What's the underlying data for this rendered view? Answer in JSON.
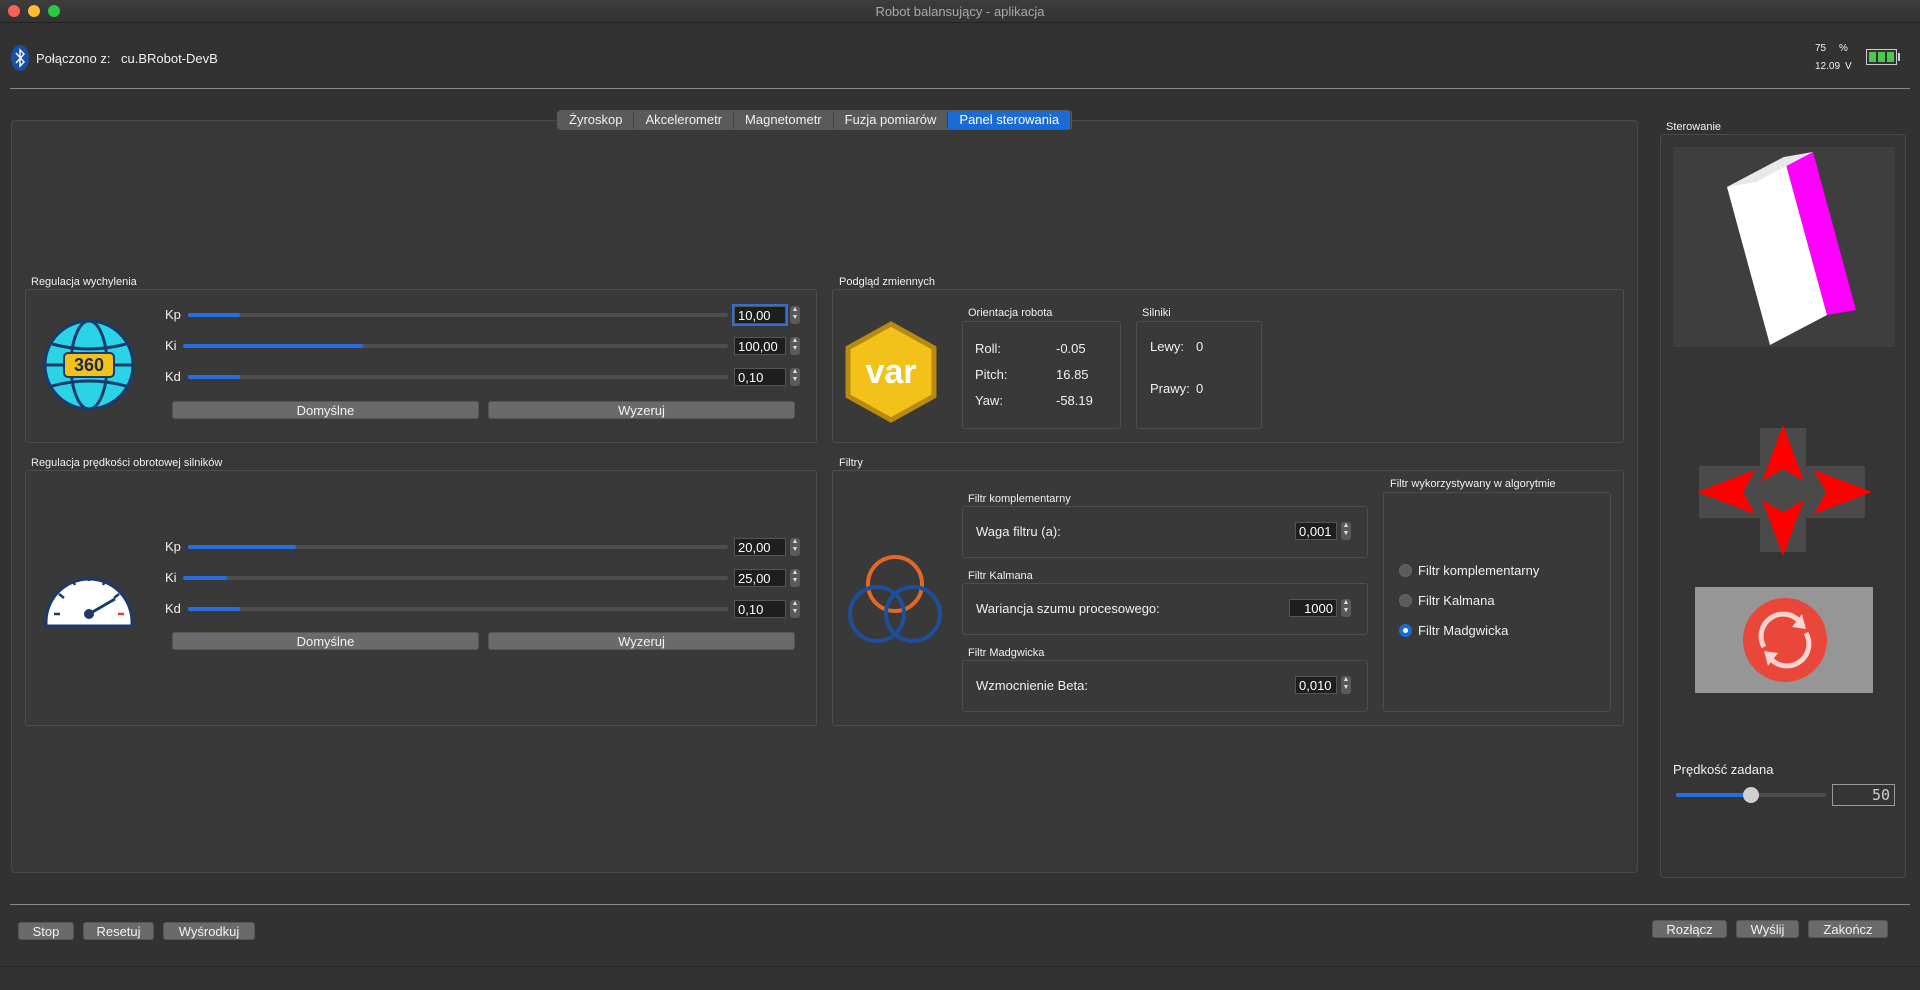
{
  "window": {
    "title": "Robot balansujący - aplikacja"
  },
  "header": {
    "connected_label": "Połączono z:",
    "device": "cu.BRobot-DevB",
    "battery_percent": "75",
    "percent_unit": "%",
    "voltage": "12.09",
    "voltage_unit": "V",
    "battery_level": 1.0
  },
  "tabs": [
    "Żyroskop",
    "Akcelerometr",
    "Magnetometr",
    "Fuzja pomiarów",
    "Panel sterowania"
  ],
  "active_tab": 4,
  "tilt": {
    "title": "Regulacja wychylenia",
    "icon_text": "360",
    "rows": [
      {
        "label": "Kp",
        "value": "10,00",
        "level": 0.1
      },
      {
        "label": "Ki",
        "value": "100,00",
        "level": 0.33
      },
      {
        "label": "Kd",
        "value": "0,10",
        "level": 0.1
      }
    ],
    "default_button": "Domyślne",
    "reset_button": "Wyzeruj"
  },
  "speed": {
    "title": "Regulacja prędkości obrotowej silników",
    "rows": [
      {
        "label": "Kp",
        "value": "20,00",
        "level": 0.2
      },
      {
        "label": "Ki",
        "value": "25,00",
        "level": 0.08
      },
      {
        "label": "Kd",
        "value": "0,10",
        "level": 0.1
      }
    ],
    "default_button": "Domyślne",
    "reset_button": "Wyzeruj"
  },
  "vars": {
    "title": "Podgląd zmiennych",
    "icon_text": "var",
    "orientation": {
      "title": "Orientacja robota",
      "roll_label": "Roll:",
      "roll": "-0.05",
      "pitch_label": "Pitch:",
      "pitch": "16.85",
      "yaw_label": "Yaw:",
      "yaw": "-58.19"
    },
    "motors": {
      "title": "Silniki",
      "left_label": "Lewy:",
      "left": "0",
      "right_label": "Prawy:",
      "right": "0"
    }
  },
  "filters": {
    "title": "Filtry",
    "complementary": {
      "title": "Filtr komplementarny",
      "label": "Waga filtru (a):",
      "value": "0,001"
    },
    "kalman": {
      "title": "Filtr Kalmana",
      "label": "Wariancja szumu procesowego:",
      "value": "1000"
    },
    "madgwick": {
      "title": "Filtr Madgwicka",
      "label": "Wzmocnienie Beta:",
      "value": "0,010"
    },
    "selection": {
      "title": "Filtr wykorzystywany w algorytmie",
      "options": [
        "Filtr komplementarny",
        "Filtr Kalmana",
        "Filtr Madgwicka"
      ],
      "selected": 2
    }
  },
  "control": {
    "title": "Sterowanie",
    "speed_label": "Prędkość zadana",
    "speed_value": "50",
    "speed_level": 0.5
  },
  "footer": {
    "stop": "Stop",
    "reset": "Resetuj",
    "center": "Wyśrodkuj",
    "disconnect": "Rozłącz",
    "send": "Wyślij",
    "quit": "Zakończ"
  },
  "colors": {
    "accent": "#1a6bd6",
    "arrow": "#ff0000",
    "cube_face": "#ffffff",
    "cube_side": "#ff00ff"
  }
}
